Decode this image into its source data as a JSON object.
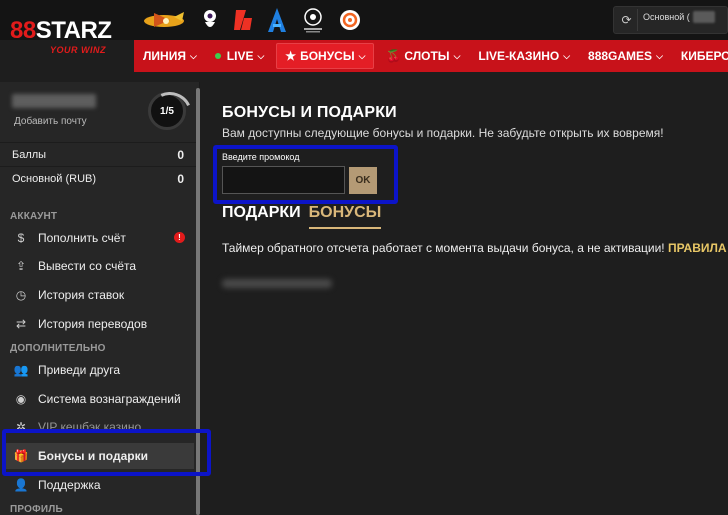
{
  "brand": {
    "name_red": "8",
    "name_mid": "8",
    "name_white": "STARZ",
    "tagline": "YOUR WINZ"
  },
  "header": {
    "partners": [
      "plane-logo-icon",
      "premier-league-icon",
      "laliga-icon",
      "serie-a-icon",
      "champions-league-icon",
      "europa-league-icon"
    ],
    "balance_label": "Основной ("
  },
  "nav": [
    {
      "label": "ЛИНИЯ"
    },
    {
      "label": "LIVE"
    },
    {
      "label": "БОНУСЫ"
    },
    {
      "label": "СЛОТЫ"
    },
    {
      "label": "LIVE-КАЗИНО"
    },
    {
      "label": "888GAMES"
    },
    {
      "label": "КИБЕРСПОРТ"
    }
  ],
  "sidebar": {
    "add_email": "Добавить почту",
    "level": "1/5",
    "stats": [
      {
        "label": "Баллы",
        "value": "0"
      },
      {
        "label": "Основной (RUB)",
        "value": "0"
      }
    ],
    "section_account": "АККАУНТ",
    "section_extra": "ДОПОЛНИТЕЛЬНО",
    "section_profile": "ПРОФИЛЬ",
    "items": [
      {
        "label": "Пополнить счёт",
        "icon": "dollar-icon",
        "badge": "!"
      },
      {
        "label": "Вывести со счёта",
        "icon": "upload-icon"
      },
      {
        "label": "История ставок",
        "icon": "clock-icon"
      },
      {
        "label": "История переводов",
        "icon": "transfer-icon"
      },
      {
        "label": "Приведи друга",
        "icon": "users-icon"
      },
      {
        "label": "Система вознаграждений",
        "icon": "coin-icon"
      },
      {
        "label": "VIP кешбэк казино",
        "icon": "vip-icon"
      },
      {
        "label": "Бонусы и подарки",
        "icon": "gift-icon"
      },
      {
        "label": "Поддержка",
        "icon": "support-icon"
      }
    ]
  },
  "main": {
    "title": "БОНУСЫ И ПОДАРКИ",
    "subtitle": "Вам доступны следующие бонусы и подарки. Не забудьте открыть их вовремя!",
    "promo_label": "Введите промокод",
    "promo_value": "",
    "ok_label": "OK",
    "tab_gifts": "ПОДАРКИ",
    "tab_bonuses": "БОНУСЫ",
    "timer_text": "Таймер обратного отсчета работает с момента выдачи бонуса, а не активации!",
    "rules_link": "ПРАВИЛА"
  },
  "colors": {
    "brand_red": "#c8121a",
    "accent_gold": "#d9b77a",
    "highlight_blue": "#0c14c8"
  }
}
